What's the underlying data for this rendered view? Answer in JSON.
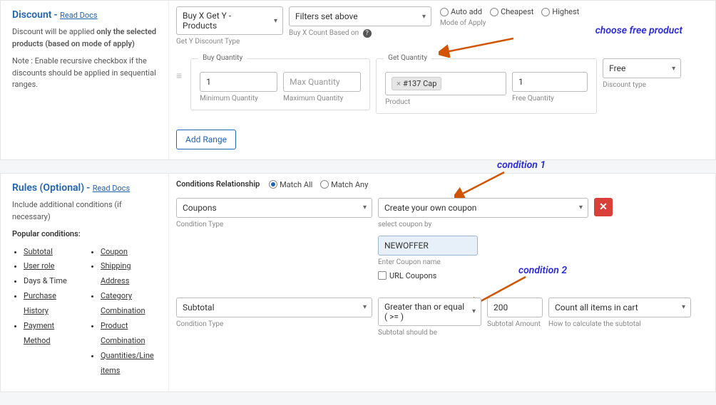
{
  "discount": {
    "title": "Discount",
    "dash": "- ",
    "read_docs": "Read Docs",
    "help1_a": "Discount will be applied ",
    "help1_b": "only the selected products (based on mode of apply)",
    "help2": "Note : Enable recursive checkbox if the discounts should be applied in sequential ranges.",
    "get_y_type": "Buy X Get Y - Products",
    "get_y_label": "Get Y Discount Type",
    "count_based": "Filters set above",
    "count_label": "Buy X Count Based on ",
    "mode_auto": "Auto add",
    "mode_cheap": "Cheapest",
    "mode_high": "Highest",
    "mode_label": "Mode of Apply",
    "buy_legend": "Buy Quantity",
    "buy_min": "1",
    "buy_min_label": "Minimum Quantity",
    "buy_max_placeholder": "Max Quantity",
    "buy_max_label": "Maximum Quantity",
    "get_legend": "Get Quantity",
    "get_product_tag": "#137 Cap",
    "get_product_label": "Product",
    "get_free_qty": "1",
    "get_free_label": "Free Quantity",
    "disc_type": "Free",
    "disc_type_label": "Discount type",
    "add_range": "Add Range",
    "annot1": "choose free product"
  },
  "rules": {
    "title": "Rules (Optional)",
    "dash": "- ",
    "read_docs": "Read Docs",
    "help1": "Include additional conditions (if necessary)",
    "popular_label": "Popular conditions:",
    "col1": [
      "Subtotal",
      "User role",
      "Days & Time",
      "Purchase History",
      "Payment Method"
    ],
    "col2": [
      "Coupon",
      "Shipping Address",
      "Category Combination",
      "Product Combination",
      "Quantities/Line items"
    ],
    "rel_label": "Conditions Relationship",
    "match_all": "Match All",
    "match_any": "Match Any",
    "cond1_type": "Coupons",
    "cond1_type_label": "Condition Type",
    "cond1_method": "Create your own coupon",
    "cond1_method_label": "select coupon by",
    "coupon_val": "NEWOFFER",
    "coupon_label": "Enter Coupon name",
    "url_coupons": "URL Coupons",
    "cond2_type": "Subtotal",
    "cond2_type_label": "Condition Type",
    "cond2_op": "Greater than or equal ( >= )",
    "cond2_op_label": "Subtotal should be",
    "cond2_amt": "200",
    "cond2_amt_label": "Subtotal Amount",
    "cond2_calc": "Count all items in cart",
    "cond2_calc_label": "How to calculate the subtotal",
    "annot_c1": "condition 1",
    "annot_c2": "condition 2"
  }
}
